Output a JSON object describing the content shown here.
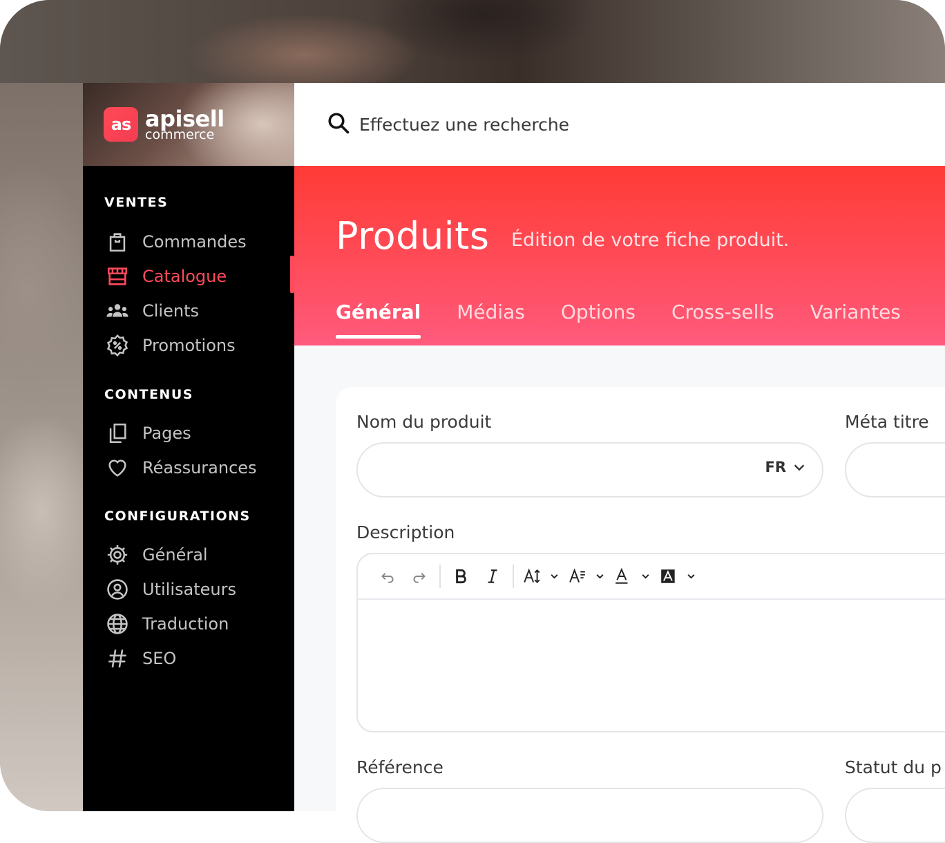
{
  "brand": {
    "badge": "as",
    "name": "apisell",
    "tagline": "commerce"
  },
  "search": {
    "placeholder": "Effectuez une recherche"
  },
  "sidebar": {
    "sections": [
      {
        "title": "VENTES"
      },
      {
        "title": "CONTENUS"
      },
      {
        "title": "CONFIGURATIONS"
      }
    ],
    "items": [
      {
        "label": "Commandes",
        "icon": "shopping-bag-icon"
      },
      {
        "label": "Catalogue",
        "icon": "storefront-icon",
        "active": true
      },
      {
        "label": "Clients",
        "icon": "users-icon"
      },
      {
        "label": "Promotions",
        "icon": "discount-badge-icon"
      },
      {
        "label": "Pages",
        "icon": "pages-icon"
      },
      {
        "label": "Réassurances",
        "icon": "heart-icon"
      },
      {
        "label": "Général",
        "icon": "gear-icon"
      },
      {
        "label": "Utilisateurs",
        "icon": "user-circle-icon"
      },
      {
        "label": "Traduction",
        "icon": "globe-icon"
      },
      {
        "label": "SEO",
        "icon": "hash-icon"
      }
    ],
    "accent_color": "#ff4a5b"
  },
  "header": {
    "title": "Produits",
    "subtitle": "Édition de votre fiche produit.",
    "tabs": [
      {
        "label": "Général",
        "active": true
      },
      {
        "label": "Médias"
      },
      {
        "label": "Options"
      },
      {
        "label": "Cross-sells"
      },
      {
        "label": "Variantes"
      }
    ]
  },
  "form": {
    "product_name_label": "Nom du produit",
    "product_name_value": "",
    "language": "FR",
    "meta_title_label": "Méta titre",
    "description_label": "Description",
    "reference_label": "Référence",
    "status_label": "Statut du p"
  }
}
